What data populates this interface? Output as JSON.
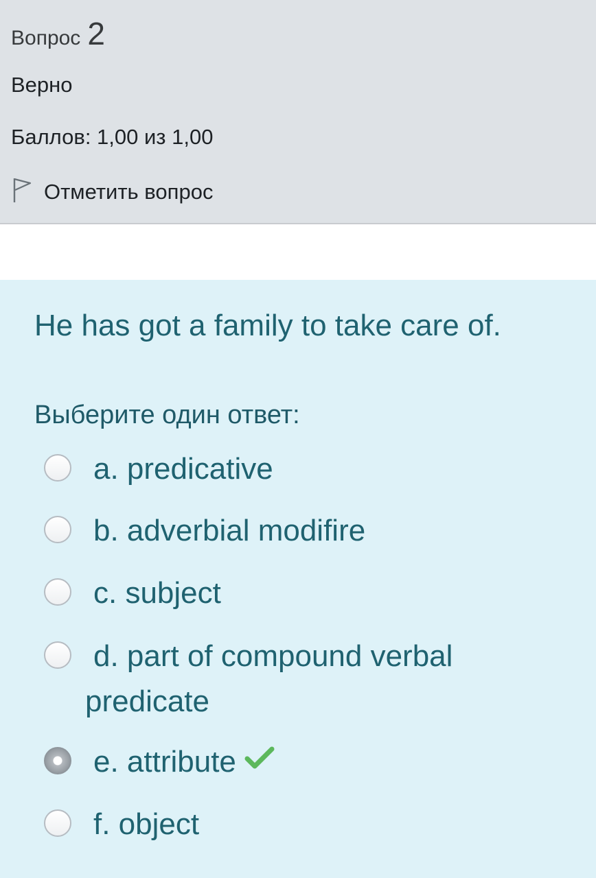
{
  "info": {
    "question_word": "Вопрос",
    "question_number": "2",
    "state": "Верно",
    "grade": "Баллов: 1,00 из 1,00",
    "flag_label": "Отметить вопрос"
  },
  "question": {
    "text": "He has got a family to take care of.",
    "prompt": "Выберите один ответ:",
    "options": [
      {
        "label": "a. predicative",
        "selected": false
      },
      {
        "label": "b. adverbial modifire",
        "selected": false
      },
      {
        "label": "c. subject",
        "selected": false
      },
      {
        "label_line1": "d. part of compound verbal",
        "label_line2": "predicate",
        "selected": false
      },
      {
        "label": "e. attribute",
        "selected": true,
        "correct": true
      },
      {
        "label": "f. object",
        "selected": false
      }
    ]
  },
  "colors": {
    "info_bg": "#dee2e6",
    "content_bg": "#def2f8",
    "question_text": "#1f6270",
    "correct_check": "#5cb85c"
  },
  "icons": {
    "flag": "flag-icon",
    "correct": "check-icon"
  }
}
